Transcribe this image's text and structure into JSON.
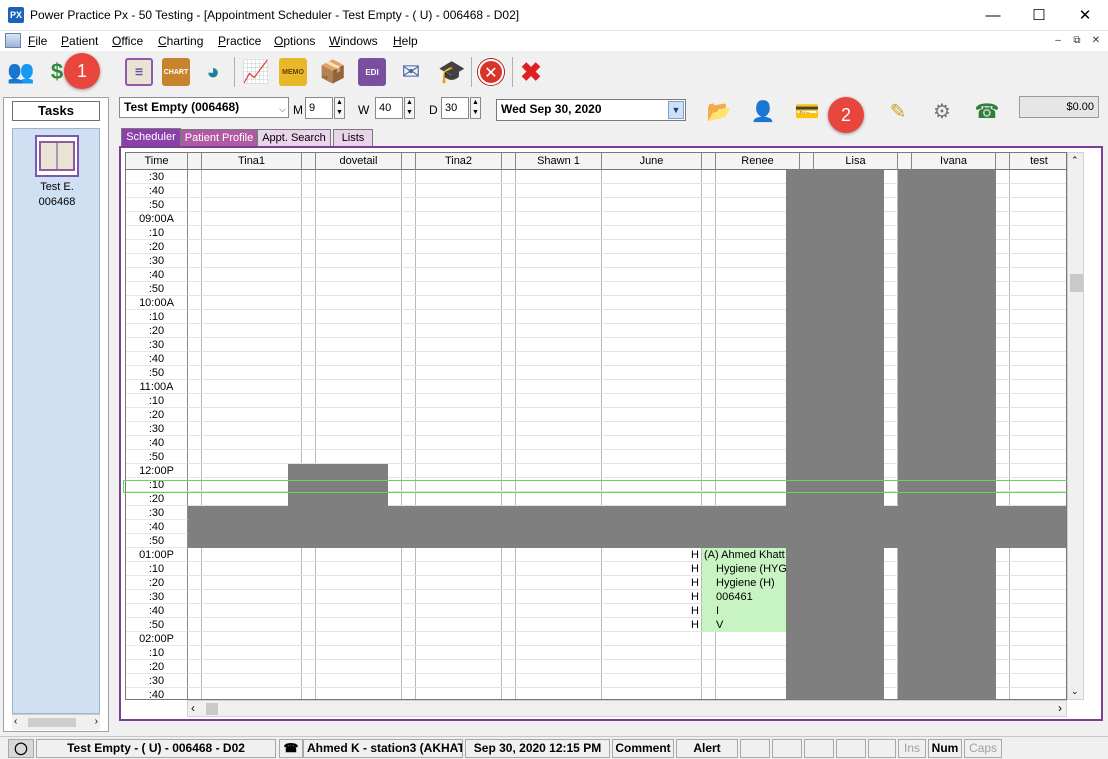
{
  "window": {
    "title": "Power Practice Px - 50 Testing - [Appointment Scheduler - Test Empty - ( U) - 006468 - D02]",
    "app_icon": "PX"
  },
  "menu": [
    "File",
    "Patient",
    "Office",
    "Charting",
    "Practice",
    "Options",
    "Windows",
    "Help"
  ],
  "toolbar": {
    "icons": [
      "users-icon",
      "money-icon",
      "scheduler-book-icon",
      "chart-icon",
      "recall-icon",
      "report-icon",
      "memo-icon",
      "box-icon",
      "edi-icon",
      "mail-icon",
      "graduation-cap-icon",
      "stop-icon",
      "exit-icon"
    ],
    "chart_label": "CHART",
    "memo_label": "MEMO",
    "edi_label": "EDI"
  },
  "callouts": [
    "1",
    "2"
  ],
  "tasks": {
    "header": "Tasks",
    "item_name": "Test E.",
    "item_id": "006468"
  },
  "controls": {
    "patient_combo": "Test Empty (006468)",
    "m_label": "M",
    "m_value": "9",
    "w_label": "W",
    "w_value": "40",
    "d_label": "D",
    "d_value": "30",
    "date": "Wed  Sep 30, 2020",
    "balance": "$0.00"
  },
  "tabs": [
    "Scheduler",
    "Patient Profile",
    "Appt. Search",
    "Lists"
  ],
  "scheduler": {
    "time_header": "Time",
    "columns": [
      "Tina1",
      "dovetail",
      "Tina2",
      "Shawn 1",
      "June",
      "Renee",
      "Lisa",
      "Ivana",
      "test"
    ],
    "times": [
      ":30",
      ":40",
      ":50",
      "09:00A",
      ":10",
      ":20",
      ":30",
      ":40",
      ":50",
      "10:00A",
      ":10",
      ":20",
      ":30",
      ":40",
      ":50",
      "11:00A",
      ":10",
      ":20",
      ":30",
      ":40",
      ":50",
      "12:00P",
      ":10",
      ":20",
      ":30",
      ":40",
      ":50",
      "01:00P",
      ":10",
      ":20",
      ":30",
      ":40",
      ":50",
      "02:00P",
      ":10",
      ":20",
      ":30",
      ":40"
    ],
    "appointment": {
      "column": "Renee",
      "marker": "H",
      "lines": [
        "(A) Ahmed Khatt",
        "Hygiene (HYG",
        "Hygiene (H)",
        "006461",
        "I",
        "V"
      ]
    }
  },
  "status": {
    "patient": "Test Empty - ( U) - 006468 - D02",
    "user": "Ahmed K - station3 (AKHAT",
    "datetime": "Sep 30, 2020 12:15 PM",
    "comment": "Comment",
    "alert": "Alert",
    "ins": "Ins",
    "num": "Num",
    "caps": "Caps"
  },
  "colors": {
    "accent_purple": "#7b3f96",
    "tab_active": "#8b3fa8",
    "tab_profile": "#b05aa3",
    "blocked_gray": "#7f7f7f",
    "appt_green": "#c8f3c3",
    "callout_red": "#e8453c"
  }
}
